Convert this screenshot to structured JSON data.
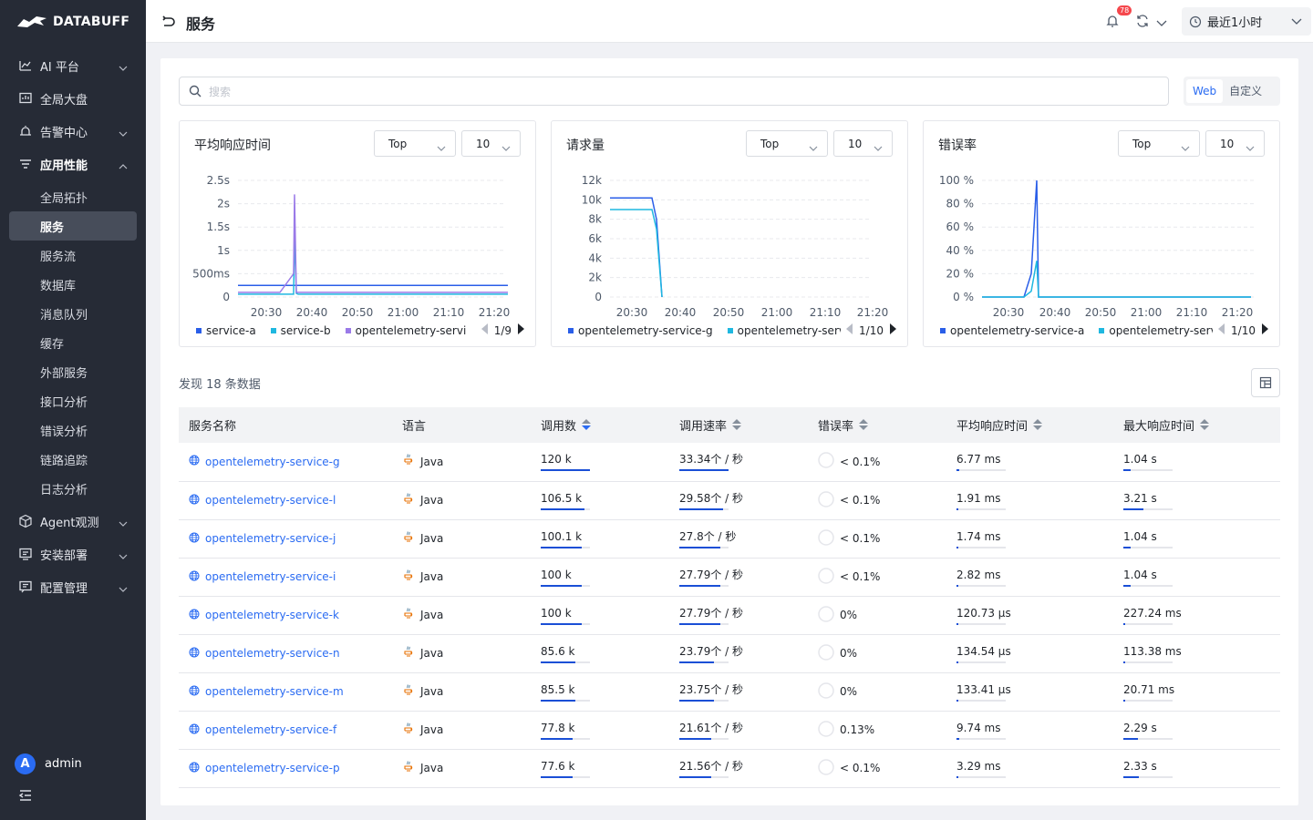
{
  "app": {
    "logo_text": "DATABUFF"
  },
  "sidebar": {
    "items": [
      {
        "label": "AI 平台",
        "icon": "chart-icon",
        "expandable": true
      },
      {
        "label": "全局大盘",
        "icon": "dashboard-icon",
        "expandable": false
      },
      {
        "label": "告警中心",
        "icon": "alarm-icon",
        "expandable": true
      },
      {
        "label": "应用性能",
        "icon": "list-icon",
        "expandable": true,
        "open": true
      },
      {
        "label": "Agent观测",
        "icon": "cube-icon",
        "expandable": true
      },
      {
        "label": "安装部署",
        "icon": "install-icon",
        "expandable": true
      },
      {
        "label": "配置管理",
        "icon": "settings-icon",
        "expandable": true
      }
    ],
    "sub_items": [
      "全局拓扑",
      "服务",
      "服务流",
      "数据库",
      "消息队列",
      "缓存",
      "外部服务",
      "接口分析",
      "错误分析",
      "链路追踪",
      "日志分析"
    ],
    "active_sub": "服务",
    "user": {
      "initial": "A",
      "name": "admin"
    }
  },
  "header": {
    "title": "服务",
    "notification_count": "78",
    "time_range": "最近1小时"
  },
  "toolbar": {
    "search_placeholder": "搜索",
    "view_options": [
      "Web",
      "自定义"
    ],
    "active_view": "Web"
  },
  "charts": [
    {
      "title": "平均响应时间",
      "top_select": "Top",
      "count_select": "10",
      "y_ticks": [
        "2.5s",
        "2s",
        "1.5s",
        "1s",
        "500ms",
        "0"
      ],
      "x_ticks": [
        "20:30",
        "20:40",
        "20:50",
        "21:00",
        "21:10",
        "21:20"
      ],
      "legend": [
        {
          "name": "service-a",
          "color": "#2a5ee8"
        },
        {
          "name": "service-b",
          "color": "#1fb8e0"
        },
        {
          "name": "opentelemetry-servi",
          "color": "#9a7ae8"
        }
      ],
      "page": "1/9"
    },
    {
      "title": "请求量",
      "top_select": "Top",
      "count_select": "10",
      "y_ticks": [
        "12k",
        "10k",
        "8k",
        "6k",
        "4k",
        "2k",
        "0"
      ],
      "x_ticks": [
        "20:30",
        "20:40",
        "20:50",
        "21:00",
        "21:10",
        "21:20"
      ],
      "legend": [
        {
          "name": "opentelemetry-service-g",
          "color": "#2a5ee8"
        },
        {
          "name": "opentelemetry-servi",
          "color": "#1fb8e0"
        }
      ],
      "page": "1/10"
    },
    {
      "title": "错误率",
      "top_select": "Top",
      "count_select": "10",
      "y_ticks": [
        "100 %",
        "80 %",
        "60 %",
        "40 %",
        "20 %",
        "0 %"
      ],
      "x_ticks": [
        "20:30",
        "20:40",
        "20:50",
        "21:00",
        "21:10",
        "21:20"
      ],
      "legend": [
        {
          "name": "opentelemetry-service-a",
          "color": "#2a5ee8"
        },
        {
          "name": "opentelemetry-servi",
          "color": "#1fb8e0"
        }
      ],
      "page": "1/10"
    }
  ],
  "chart_data": [
    {
      "type": "line",
      "title": "平均响应时间",
      "x": [
        "20:26",
        "20:30",
        "20:34",
        "20:35",
        "20:36",
        "20:37",
        "21:20"
      ],
      "ylim": [
        0,
        2.5
      ],
      "series": [
        {
          "name": "service-a",
          "values": [
            0.25,
            0.25,
            0.25,
            0.25,
            0.25,
            0.25,
            0.25
          ]
        },
        {
          "name": "service-b",
          "values": [
            0.06,
            0.06,
            0.06,
            1.4,
            0.08,
            0.06,
            0.06
          ]
        },
        {
          "name": "opentelemetry-servi",
          "values": [
            0.1,
            0.1,
            0.5,
            2.2,
            0.1,
            0.1,
            0.1
          ]
        }
      ]
    },
    {
      "type": "line",
      "title": "请求量",
      "x": [
        "20:26",
        "20:30",
        "20:35",
        "20:36",
        "20:37"
      ],
      "ylim": [
        0,
        12000
      ],
      "series": [
        {
          "name": "opentelemetry-service-g",
          "values": [
            10200,
            10200,
            10200,
            8000,
            0
          ]
        },
        {
          "name": "opentelemetry-servi",
          "values": [
            9000,
            9000,
            9000,
            7000,
            0
          ]
        }
      ]
    },
    {
      "type": "line",
      "title": "错误率",
      "x": [
        "20:26",
        "20:30",
        "20:34",
        "20:35",
        "20:36"
      ],
      "ylim": [
        0,
        100
      ],
      "series": [
        {
          "name": "opentelemetry-service-a",
          "values": [
            0,
            0,
            20,
            100,
            0
          ]
        },
        {
          "name": "opentelemetry-servi",
          "values": [
            0,
            0,
            5,
            31,
            0
          ]
        }
      ]
    }
  ],
  "table": {
    "found_text": "发现 18 条数据",
    "columns": [
      "服务名称",
      "语言",
      "调用数",
      "调用速率",
      "错误率",
      "平均响应时间",
      "最大响应时间"
    ],
    "rows": [
      {
        "name": "opentelemetry-service-g",
        "lang": "Java",
        "calls": "120 k",
        "calls_pct": 1.0,
        "rate": "33.34个 / 秒",
        "rate_pct": 1.0,
        "err": "< 0.1%",
        "avg": "6.77 ms",
        "avg_pct": 0.05,
        "max": "1.04 s",
        "max_pct": 0.15
      },
      {
        "name": "opentelemetry-service-l",
        "lang": "Java",
        "calls": "106.5 k",
        "calls_pct": 0.89,
        "rate": "29.58个 / 秒",
        "rate_pct": 0.89,
        "err": "< 0.1%",
        "avg": "1.91 ms",
        "avg_pct": 0.02,
        "max": "3.21 s",
        "max_pct": 0.4
      },
      {
        "name": "opentelemetry-service-j",
        "lang": "Java",
        "calls": "100.1 k",
        "calls_pct": 0.83,
        "rate": "27.8个 / 秒",
        "rate_pct": 0.83,
        "err": "< 0.1%",
        "avg": "1.74 ms",
        "avg_pct": 0.02,
        "max": "1.04 s",
        "max_pct": 0.15
      },
      {
        "name": "opentelemetry-service-i",
        "lang": "Java",
        "calls": "100 k",
        "calls_pct": 0.83,
        "rate": "27.79个 / 秒",
        "rate_pct": 0.83,
        "err": "< 0.1%",
        "avg": "2.82 ms",
        "avg_pct": 0.03,
        "max": "1.04 s",
        "max_pct": 0.15
      },
      {
        "name": "opentelemetry-service-k",
        "lang": "Java",
        "calls": "100 k",
        "calls_pct": 0.83,
        "rate": "27.79个 / 秒",
        "rate_pct": 0.83,
        "err": "0%",
        "avg": "120.73 μs",
        "avg_pct": 0.01,
        "max": "227.24 ms",
        "max_pct": 0.04
      },
      {
        "name": "opentelemetry-service-n",
        "lang": "Java",
        "calls": "85.6 k",
        "calls_pct": 0.71,
        "rate": "23.79个 / 秒",
        "rate_pct": 0.71,
        "err": "0%",
        "avg": "134.54 μs",
        "avg_pct": 0.01,
        "max": "113.38 ms",
        "max_pct": 0.02
      },
      {
        "name": "opentelemetry-service-m",
        "lang": "Java",
        "calls": "85.5 k",
        "calls_pct": 0.71,
        "rate": "23.75个 / 秒",
        "rate_pct": 0.71,
        "err": "0%",
        "avg": "133.41 μs",
        "avg_pct": 0.01,
        "max": "20.71 ms",
        "max_pct": 0.01
      },
      {
        "name": "opentelemetry-service-f",
        "lang": "Java",
        "calls": "77.8 k",
        "calls_pct": 0.65,
        "rate": "21.61个 / 秒",
        "rate_pct": 0.65,
        "err": "0.13%",
        "avg": "9.74 ms",
        "avg_pct": 0.06,
        "max": "2.29 s",
        "max_pct": 0.3
      },
      {
        "name": "opentelemetry-service-p",
        "lang": "Java",
        "calls": "77.6 k",
        "calls_pct": 0.65,
        "rate": "21.56个 / 秒",
        "rate_pct": 0.65,
        "err": "< 0.1%",
        "avg": "3.29 ms",
        "avg_pct": 0.03,
        "max": "2.33 s",
        "max_pct": 0.32
      }
    ]
  },
  "colors": {
    "accent": "#2a6bf2",
    "sidebar_bg": "#262b36",
    "bar_fill": "#1a4fd6"
  }
}
